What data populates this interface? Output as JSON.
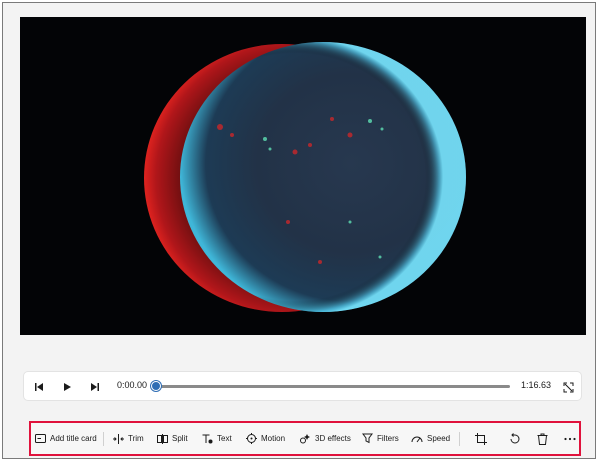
{
  "player": {
    "current_time": "0:00.00",
    "total_time": "1:16.63",
    "progress": 0.0
  },
  "toolbar": {
    "add_title_card": "Add title card",
    "trim": "Trim",
    "split": "Split",
    "text": "Text",
    "motion": "Motion",
    "effects_3d": "3D effects",
    "filters": "Filters",
    "speed": "Speed"
  },
  "colors": {
    "highlight_border": "#e0123c",
    "accent": "#2e6db4",
    "video_bg": "#030406"
  },
  "icons": [
    "previous-frame-icon",
    "play-icon",
    "next-frame-icon",
    "fullscreen-icon",
    "title-card-icon",
    "trim-icon",
    "split-icon",
    "text-icon",
    "motion-icon",
    "3d-effects-icon",
    "filters-icon",
    "speed-icon",
    "crop-icon",
    "rotate-icon",
    "delete-icon",
    "more-icon"
  ]
}
